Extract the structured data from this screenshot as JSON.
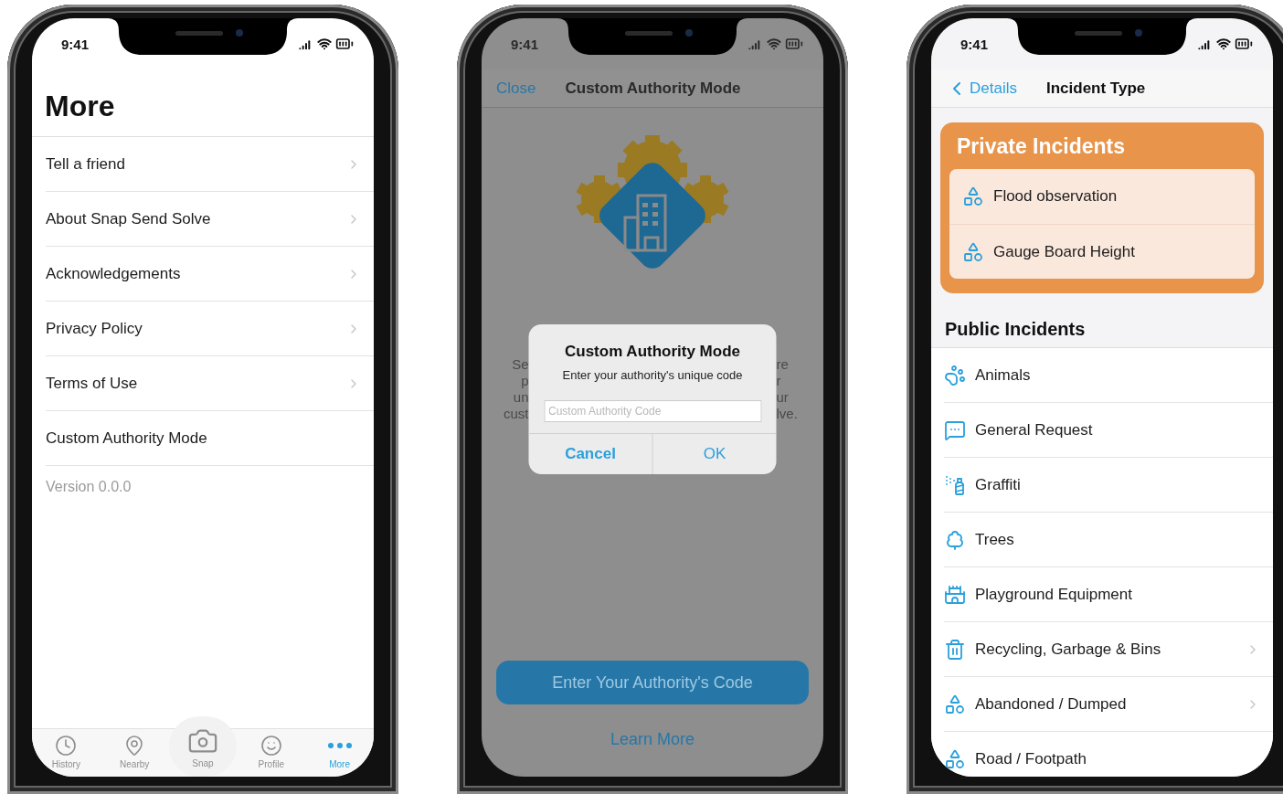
{
  "screens": [
    {
      "kind": "more",
      "status_time": "9:41",
      "title": "More",
      "items": [
        {
          "label": "Tell a friend",
          "chevron": true
        },
        {
          "label": "About Snap Send Solve",
          "chevron": true
        },
        {
          "label": "Acknowledgements",
          "chevron": true
        },
        {
          "label": "Privacy Policy",
          "chevron": true
        },
        {
          "label": "Terms of Use",
          "chevron": true
        },
        {
          "label": "Custom Authority Mode",
          "chevron": false
        }
      ],
      "version": "Version 0.0.0",
      "tabs": [
        {
          "kind": "history",
          "label": "History",
          "selected": false
        },
        {
          "kind": "nearby",
          "label": "Nearby",
          "selected": false
        },
        {
          "kind": "snap",
          "label": "Snap",
          "selected": false
        },
        {
          "kind": "profile",
          "label": "Profile",
          "selected": false
        },
        {
          "kind": "more",
          "label": "More",
          "selected": true
        }
      ]
    },
    {
      "kind": "authority",
      "status_time": "9:41",
      "nav_back": "Close",
      "nav_title": "Custom Authority Mode",
      "fragments_left": [
        "Se",
        "p",
        "un",
        "cust"
      ],
      "fragments_right": [
        "re",
        "r",
        "ur",
        "lve."
      ],
      "dialog": {
        "title": "Custom Authority Mode",
        "message": "Enter your authority's unique code",
        "placeholder": "Custom Authority Code",
        "buttons": [
          "Cancel",
          "OK"
        ]
      },
      "primary_button": "Enter Your Authority's Code",
      "link": "Learn More"
    },
    {
      "kind": "incidents",
      "status_time": "9:41",
      "nav_back": "Details",
      "nav_title": "Incident Type",
      "private_title": "Private Incidents",
      "private_items": [
        {
          "kind": "shapes",
          "label": "Flood observation"
        },
        {
          "kind": "shapes",
          "label": "Gauge Board Height"
        }
      ],
      "public_title": "Public Incidents",
      "public_items": [
        {
          "kind": "paw",
          "label": "Animals",
          "chevron": false
        },
        {
          "kind": "chat",
          "label": "General Request",
          "chevron": false
        },
        {
          "kind": "spray",
          "label": "Graffiti",
          "chevron": false
        },
        {
          "kind": "tree",
          "label": "Trees",
          "chevron": false
        },
        {
          "kind": "playground",
          "label": "Playground Equipment",
          "chevron": false
        },
        {
          "kind": "bin",
          "label": "Recycling, Garbage & Bins",
          "chevron": true
        },
        {
          "kind": "shapes",
          "label": "Abandoned / Dumped",
          "chevron": true
        },
        {
          "kind": "shapes",
          "label": "Road / Footpath",
          "chevron": false
        }
      ]
    }
  ]
}
